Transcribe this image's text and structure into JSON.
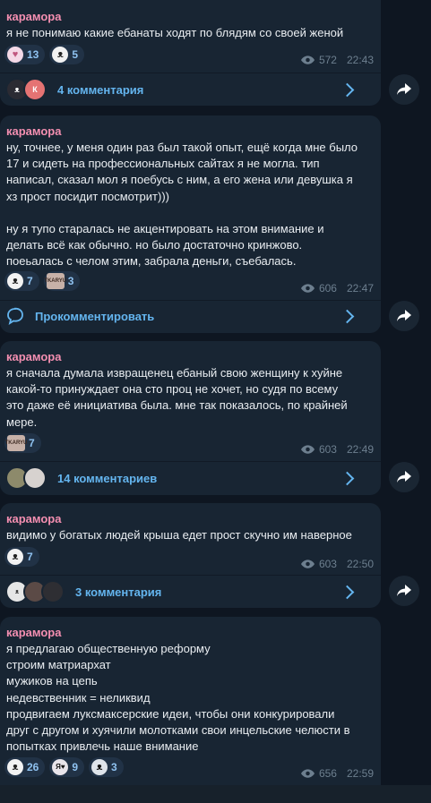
{
  "posts": [
    {
      "author": "карамора",
      "text": [
        "я не понимаю какие ебанаты ходят по блядям со своей женой"
      ],
      "reactions": [
        {
          "emoji": "bunny-sticker-icon",
          "count": "13"
        },
        {
          "emoji": "kitty-sticker-icon",
          "count": "5"
        }
      ],
      "views": "572",
      "time": "22:43",
      "comments": "4 комментария"
    },
    {
      "author": "карамора",
      "text": [
        "ну, точнее, у меня один раз был такой опыт, ещё когда мне было",
        "17 и сидеть на профессиональных сайтах я не могла. тип",
        "написал, сказал мол я поебусь с ним, а его жена или девушка я",
        "хз прост посидит посмотрит)))",
        "",
        "ну я тупо старалась не акцентировать на этом внимание и",
        "делать всё как обычно. но было достаточно кринжово.",
        "поеьалась с челом этим, забрала деньги, съебалась."
      ],
      "reactions": [
        {
          "emoji": "kitty-sticker-icon",
          "count": "7"
        },
        {
          "emoji": "tkaryu-sticker-icon",
          "count": "3"
        }
      ],
      "views": "606",
      "time": "22:47",
      "comments": "Прокомментировать"
    },
    {
      "author": "карамора",
      "text": [
        "я сначала думала извращенец ебаный свою женщину к хуйне",
        "какой-то принуждает она сто проц не хочет, но судя по всему",
        "это даже её инициатива была. мне так показалось, по крайней",
        "мере."
      ],
      "reactions": [
        {
          "emoji": "tkaryu-sticker-icon",
          "count": "7"
        }
      ],
      "views": "603",
      "time": "22:49",
      "comments": "14 комментариев"
    },
    {
      "author": "карамора",
      "text": [
        "видимо у богатых людей крыша едет прост скучно им наверное"
      ],
      "reactions": [
        {
          "emoji": "kitty-sticker-icon",
          "count": "7"
        }
      ],
      "views": "603",
      "time": "22:50",
      "comments": "3 комментария"
    },
    {
      "author": "карамора",
      "text": [
        "я предлагаю общественную реформу",
        "строим матриархат",
        "мужиков на цепь",
        "недевственник = неликвид",
        "продвигаем луксмаксерские идеи, чтобы они конкурировали",
        "друг с другом и хуячили молотками свои инцельские челюсти в",
        "попытках привлечь наше внимание"
      ],
      "reactions": [
        {
          "emoji": "kitty-sticker-icon",
          "count": "26"
        },
        {
          "emoji": "face-sticker-icon",
          "count": "9"
        },
        {
          "emoji": "panda-sticker-icon",
          "count": "3"
        }
      ],
      "views": "656",
      "time": "22:59"
    }
  ],
  "avatar_letter": "К",
  "sticker_text": "TKARYU",
  "face_sticker_text": "Я♥",
  "colors": {
    "background": "#0e1621",
    "bubble": "#182533",
    "author": "#f48fb1",
    "link": "#64b5ef"
  }
}
